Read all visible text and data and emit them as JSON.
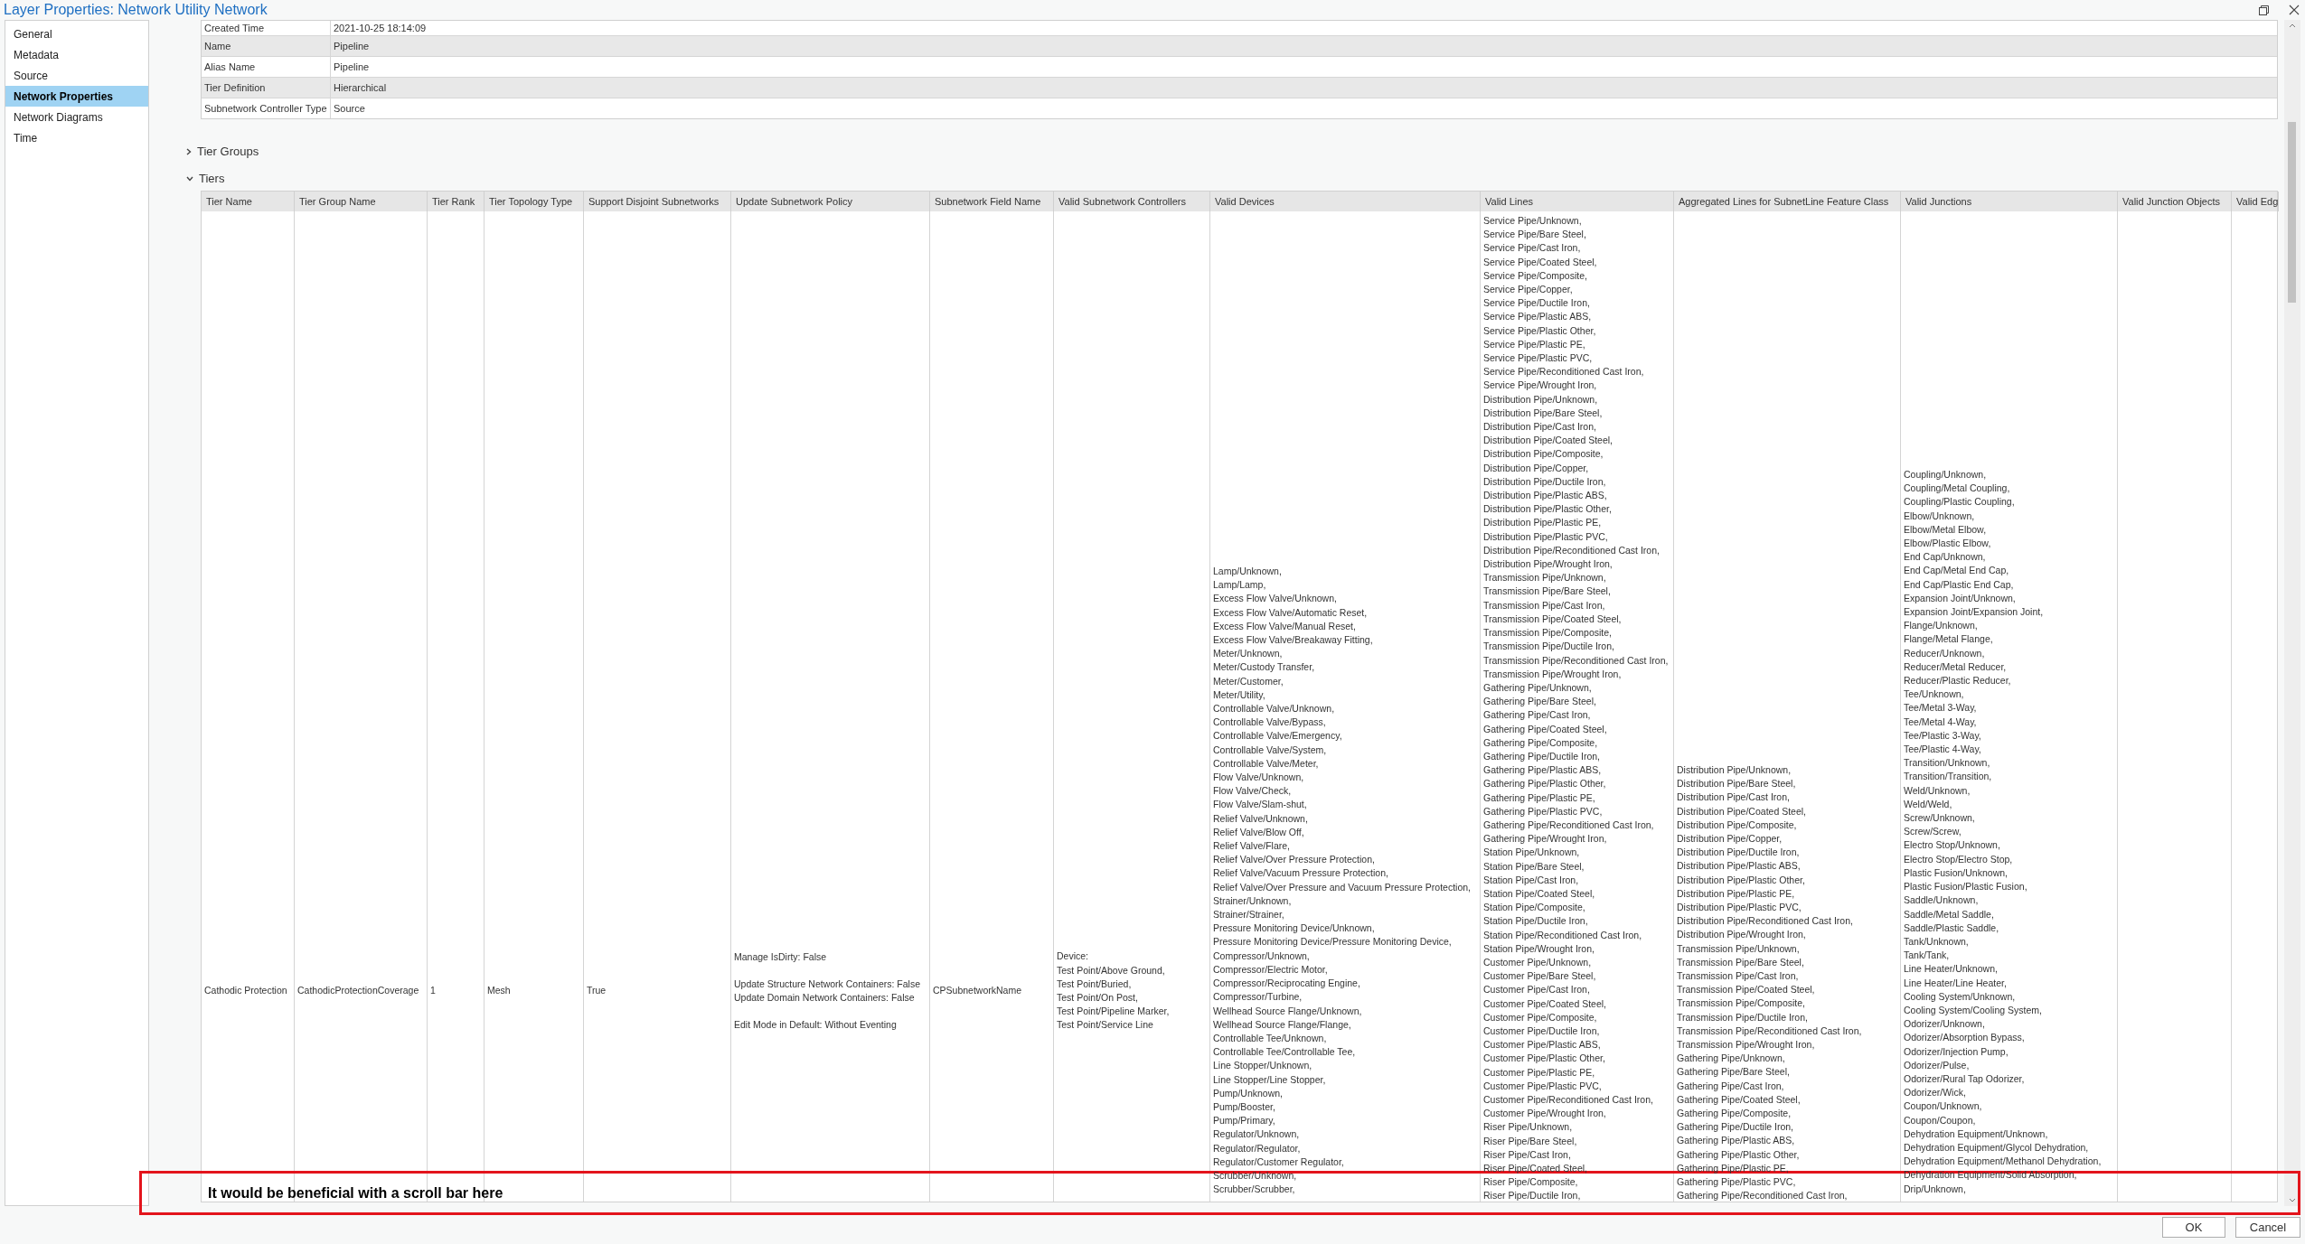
{
  "window": {
    "title": "Layer Properties: Network Utility Network",
    "buttons": [
      "OK",
      "Cancel"
    ]
  },
  "sidebar": {
    "items": [
      {
        "label": "General",
        "selected": false
      },
      {
        "label": "Metadata",
        "selected": false
      },
      {
        "label": "Source",
        "selected": false
      },
      {
        "label": "Network Properties",
        "selected": true
      },
      {
        "label": "Network Diagrams",
        "selected": false
      },
      {
        "label": "Time",
        "selected": false
      }
    ]
  },
  "properties": [
    {
      "label": "Created Time",
      "value": "2021-10-25 18:14:09"
    },
    {
      "label": "Name",
      "value": "Pipeline"
    },
    {
      "label": "Alias Name",
      "value": "Pipeline"
    },
    {
      "label": "Tier Definition",
      "value": "Hierarchical"
    },
    {
      "label": "Subnetwork Controller Type",
      "value": "Source"
    }
  ],
  "sections": [
    {
      "label": "Tier Groups",
      "expanded": false
    },
    {
      "label": "Tiers",
      "expanded": true
    }
  ],
  "tiers_table": {
    "columns": [
      "Tier Name",
      "Tier Group Name",
      "Tier Rank",
      "Tier Topology Type",
      "Support Disjoint Subnetworks",
      "Update Subnetwork Policy",
      "Subnetwork Field Name",
      "Valid Subnetwork Controllers",
      "Valid Devices",
      "Valid Lines",
      "Aggregated Lines for SubnetLine Feature Class",
      "Valid Junctions",
      "Valid Junction Objects",
      "Valid Edg"
    ],
    "rows": [
      {
        "cells": [
          [
            [
              "Cathodic Protection"
            ]
          ],
          [
            [
              "CathodicProtectionCoverage"
            ]
          ],
          [
            [
              "1"
            ]
          ],
          [
            [
              "Mesh"
            ]
          ],
          [
            [
              "True"
            ]
          ],
          [
            [
              "Manage IsDirty: False"
            ],
            [
              "Update Structure Network Containers: False",
              "Update Domain Network Containers: False"
            ],
            [
              "Edit Mode in Default: Without Eventing"
            ]
          ],
          [
            [
              "CPSubnetworkName"
            ]
          ],
          [
            [
              "Device:",
              "Test Point/Above Ground,",
              "Test Point/Buried,",
              "Test Point/On Post,",
              "Test Point/Pipeline Marker,",
              "Test Point/Service Line"
            ]
          ],
          [
            [
              "Lamp/Unknown,",
              "Lamp/Lamp,",
              "Excess Flow Valve/Unknown,",
              "Excess Flow Valve/Automatic Reset,",
              "Excess Flow Valve/Manual Reset,",
              "Excess Flow Valve/Breakaway Fitting,",
              "Meter/Unknown,",
              "Meter/Custody Transfer,",
              "Meter/Customer,",
              "Meter/Utility,",
              "Controllable Valve/Unknown,",
              "Controllable Valve/Bypass,",
              "Controllable Valve/Emergency,",
              "Controllable Valve/System,",
              "Controllable Valve/Meter,",
              "Flow Valve/Unknown,",
              "Flow Valve/Check,",
              "Flow Valve/Slam-shut,",
              "Relief Valve/Unknown,",
              "Relief Valve/Blow Off,",
              "Relief Valve/Flare,",
              "Relief Valve/Over Pressure Protection,",
              "Relief Valve/Vacuum Pressure Protection,",
              "Relief Valve/Over Pressure and Vacuum Pressure Protection,",
              "Strainer/Unknown,",
              "Strainer/Strainer,",
              "Pressure Monitoring Device/Unknown,",
              "Pressure Monitoring Device/Pressure Monitoring Device,",
              "Compressor/Unknown,",
              "Compressor/Electric Motor,",
              "Compressor/Reciprocating Engine,",
              "Compressor/Turbine,",
              "Wellhead Source Flange/Unknown,",
              "Wellhead Source Flange/Flange,",
              "Controllable Tee/Unknown,",
              "Controllable Tee/Controllable Tee,",
              "Line Stopper/Unknown,",
              "Line Stopper/Line Stopper,",
              "Pump/Unknown,",
              "Pump/Booster,",
              "Pump/Primary,",
              "Regulator/Unknown,",
              "Regulator/Regulator,",
              "Regulator/Customer Regulator,",
              "Scrubber/Unknown,",
              "Scrubber/Scrubber,"
            ]
          ],
          [
            [
              "Service Pipe/Unknown,",
              "Service Pipe/Bare Steel,",
              "Service Pipe/Cast Iron,",
              "Service Pipe/Coated Steel,",
              "Service Pipe/Composite,",
              "Service Pipe/Copper,",
              "Service Pipe/Ductile Iron,",
              "Service Pipe/Plastic ABS,",
              "Service Pipe/Plastic Other,",
              "Service Pipe/Plastic PE,",
              "Service Pipe/Plastic PVC,",
              "Service Pipe/Reconditioned Cast Iron,",
              "Service Pipe/Wrought Iron,",
              "Distribution Pipe/Unknown,",
              "Distribution Pipe/Bare Steel,",
              "Distribution Pipe/Cast Iron,",
              "Distribution Pipe/Coated Steel,",
              "Distribution Pipe/Composite,",
              "Distribution Pipe/Copper,",
              "Distribution Pipe/Ductile Iron,",
              "Distribution Pipe/Plastic ABS,",
              "Distribution Pipe/Plastic Other,",
              "Distribution Pipe/Plastic PE,",
              "Distribution Pipe/Plastic PVC,",
              "Distribution Pipe/Reconditioned Cast Iron,",
              "Distribution Pipe/Wrought Iron,",
              "Transmission Pipe/Unknown,",
              "Transmission Pipe/Bare Steel,",
              "Transmission Pipe/Cast Iron,",
              "Transmission Pipe/Coated Steel,",
              "Transmission Pipe/Composite,",
              "Transmission Pipe/Ductile Iron,",
              "Transmission Pipe/Reconditioned Cast Iron,",
              "Transmission Pipe/Wrought Iron,",
              "Gathering Pipe/Unknown,",
              "Gathering Pipe/Bare Steel,",
              "Gathering Pipe/Cast Iron,",
              "Gathering Pipe/Coated Steel,",
              "Gathering Pipe/Composite,",
              "Gathering Pipe/Ductile Iron,",
              "Gathering Pipe/Plastic ABS,",
              "Gathering Pipe/Plastic Other,",
              "Gathering Pipe/Plastic PE,",
              "Gathering Pipe/Plastic PVC,",
              "Gathering Pipe/Reconditioned Cast Iron,",
              "Gathering Pipe/Wrought Iron,",
              "Station Pipe/Unknown,",
              "Station Pipe/Bare Steel,",
              "Station Pipe/Cast Iron,",
              "Station Pipe/Coated Steel,",
              "Station Pipe/Composite,",
              "Station Pipe/Ductile Iron,",
              "Station Pipe/Reconditioned Cast Iron,",
              "Station Pipe/Wrought Iron,",
              "Customer Pipe/Unknown,",
              "Customer Pipe/Bare Steel,",
              "Customer Pipe/Cast Iron,",
              "Customer Pipe/Coated Steel,",
              "Customer Pipe/Composite,",
              "Customer Pipe/Ductile Iron,",
              "Customer Pipe/Plastic ABS,",
              "Customer Pipe/Plastic Other,",
              "Customer Pipe/Plastic PE,",
              "Customer Pipe/Plastic PVC,",
              "Customer Pipe/Reconditioned Cast Iron,",
              "Customer Pipe/Wrought Iron,",
              "Riser Pipe/Unknown,",
              "Riser Pipe/Bare Steel,",
              "Riser Pipe/Cast Iron,",
              "Riser Pipe/Coated Steel,",
              "Riser Pipe/Composite,",
              "Riser Pipe/Ductile Iron,"
            ]
          ],
          [
            [
              "Distribution Pipe/Unknown,",
              "Distribution Pipe/Bare Steel,",
              "Distribution Pipe/Cast Iron,",
              "Distribution Pipe/Coated Steel,",
              "Distribution Pipe/Composite,",
              "Distribution Pipe/Copper,",
              "Distribution Pipe/Ductile Iron,",
              "Distribution Pipe/Plastic ABS,",
              "Distribution Pipe/Plastic Other,",
              "Distribution Pipe/Plastic PE,",
              "Distribution Pipe/Plastic PVC,",
              "Distribution Pipe/Reconditioned Cast Iron,",
              "Distribution Pipe/Wrought Iron,",
              "Transmission Pipe/Unknown,",
              "Transmission Pipe/Bare Steel,",
              "Transmission Pipe/Cast Iron,",
              "Transmission Pipe/Coated Steel,",
              "Transmission Pipe/Composite,",
              "Transmission Pipe/Ductile Iron,",
              "Transmission Pipe/Reconditioned Cast Iron,",
              "Transmission Pipe/Wrought Iron,",
              "Gathering Pipe/Unknown,",
              "Gathering Pipe/Bare Steel,",
              "Gathering Pipe/Cast Iron,",
              "Gathering Pipe/Coated Steel,",
              "Gathering Pipe/Composite,",
              "Gathering Pipe/Ductile Iron,",
              "Gathering Pipe/Plastic ABS,",
              "Gathering Pipe/Plastic Other,",
              "Gathering Pipe/Plastic PE,",
              "Gathering Pipe/Plastic PVC,",
              "Gathering Pipe/Reconditioned Cast Iron,"
            ]
          ],
          [
            [
              "Coupling/Unknown,",
              "Coupling/Metal Coupling,",
              "Coupling/Plastic Coupling,",
              "Elbow/Unknown,",
              "Elbow/Metal Elbow,",
              "Elbow/Plastic Elbow,",
              "End Cap/Unknown,",
              "End Cap/Metal End Cap,",
              "End Cap/Plastic End Cap,",
              "Expansion Joint/Unknown,",
              "Expansion Joint/Expansion Joint,",
              "Flange/Unknown,",
              "Flange/Metal Flange,",
              "Reducer/Unknown,",
              "Reducer/Metal Reducer,",
              "Reducer/Plastic Reducer,",
              "Tee/Unknown,",
              "Tee/Metal 3-Way,",
              "Tee/Metal 4-Way,",
              "Tee/Plastic 3-Way,",
              "Tee/Plastic 4-Way,",
              "Transition/Unknown,",
              "Transition/Transition,",
              "Weld/Unknown,",
              "Weld/Weld,",
              "Screw/Unknown,",
              "Screw/Screw,",
              "Electro Stop/Unknown,",
              "Electro Stop/Electro Stop,",
              "Plastic Fusion/Unknown,",
              "Plastic Fusion/Plastic Fusion,",
              "Saddle/Unknown,",
              "Saddle/Metal Saddle,",
              "Saddle/Plastic Saddle,",
              "Tank/Unknown,",
              "Tank/Tank,",
              "Line Heater/Unknown,",
              "Line Heater/Line Heater,",
              "Cooling System/Unknown,",
              "Cooling System/Cooling System,",
              "Odorizer/Unknown,",
              "Odorizer/Absorption Bypass,",
              "Odorizer/Injection Pump,",
              "Odorizer/Pulse,",
              "Odorizer/Rural Tap Odorizer,",
              "Odorizer/Wick,",
              "Coupon/Unknown,",
              "Coupon/Coupon,",
              "Dehydration Equipment/Unknown,",
              "Dehydration Equipment/Glycol Dehydration,",
              "Dehydration Equipment/Methanol Dehydration,",
              "Dehydration Equipment/Solid Absorption,",
              "Drip/Unknown,"
            ]
          ]
        ]
      }
    ]
  },
  "annotation": {
    "text": "It would be beneficial with a scroll bar here"
  }
}
